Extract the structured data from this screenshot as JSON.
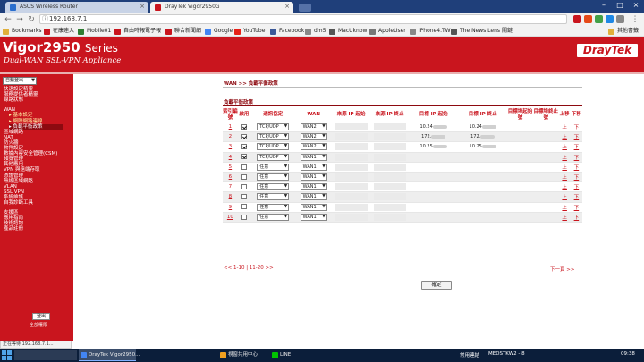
{
  "browser": {
    "tabs": [
      {
        "title": "ASUS Wireless Router",
        "active": false,
        "favicon_color": "#2a6fcf"
      },
      {
        "title": "DrayTek Vigor2950G",
        "active": true,
        "favicon_color": "#c9151e"
      }
    ],
    "address": "192.168.7.1",
    "bookmarks": [
      {
        "label": "Bookmarks",
        "color": "#e0b03c"
      },
      {
        "label": "在康連入",
        "color": "#c9151e"
      },
      {
        "label": "Mobile01",
        "color": "#2e7d32"
      },
      {
        "label": "自由時報電子報",
        "color": "#c9151e"
      },
      {
        "label": "聯合新聞網",
        "color": "#c9151e"
      },
      {
        "label": "Google",
        "color": "#4285f4"
      },
      {
        "label": "YouTube",
        "color": "#e62117"
      },
      {
        "label": "Facebook",
        "color": "#3b5998"
      },
      {
        "label": "dm5",
        "color": "#888888"
      },
      {
        "label": "MacUknow",
        "color": "#555555"
      },
      {
        "label": "AppleUser",
        "color": "#777777"
      },
      {
        "label": "iPhone4.TW",
        "color": "#888888"
      },
      {
        "label": "The News Lens 關鍵",
        "color": "#555555"
      }
    ],
    "other_bookmarks": "其他書籤",
    "status_text": "正在等待 192.168.7.1..."
  },
  "header": {
    "model": "Vigor2950",
    "series": "Series",
    "subtitle": "Dual-WAN SSL-VPN Appliance",
    "logo": "DrayTek"
  },
  "sidebar": {
    "select_label": "自動登出",
    "items": [
      {
        "label": "快速設定精靈",
        "level": "top"
      },
      {
        "label": "服務提供者精靈",
        "level": "top"
      },
      {
        "label": "線路狀態",
        "level": "top"
      },
      {
        "label": "WAN",
        "level": "top",
        "gap": true
      },
      {
        "label": "▸ 基本設定",
        "level": "sub"
      },
      {
        "label": "▸ 網際網路連線",
        "level": "sub"
      },
      {
        "label": "▸ 負載平衡政策",
        "level": "current"
      },
      {
        "label": "區域網路",
        "level": "top"
      },
      {
        "label": "NAT",
        "level": "top"
      },
      {
        "label": "防火牆",
        "level": "top"
      },
      {
        "label": "物件設定",
        "level": "top"
      },
      {
        "label": "數據內容安全管理(CSM)",
        "level": "top"
      },
      {
        "label": "頻寬管理",
        "level": "top"
      },
      {
        "label": "其他應用",
        "level": "top"
      },
      {
        "label": "VPN 與遠端存取",
        "level": "top"
      },
      {
        "label": "憑證管理",
        "level": "top"
      },
      {
        "label": "無線區域網路",
        "level": "top"
      },
      {
        "label": "VLAN",
        "level": "top"
      },
      {
        "label": "SSL VPN",
        "level": "top"
      },
      {
        "label": "系統維護",
        "level": "top"
      },
      {
        "label": "自我診斷工具",
        "level": "top"
      },
      {
        "label": "支援區",
        "level": "top",
        "gap": true
      },
      {
        "label": "應用指南",
        "level": "top"
      },
      {
        "label": "技術諮詢",
        "level": "top"
      },
      {
        "label": "產品註冊",
        "level": "top"
      }
    ],
    "logout_label": "登出",
    "permission_text": "全部權限"
  },
  "page": {
    "breadcrumb": "WAN >> 負載平衡政策",
    "section_title": "負載平衡政策",
    "columns": {
      "index": "索引編號",
      "enable": "啟用",
      "protocol": "通訊協定",
      "wan": "WAN",
      "src_ip_start": "來源 IP 起始",
      "src_ip_end": "來源 IP 終止",
      "dst_ip_start": "目標 IP 起始",
      "dst_ip_end": "目標 IP 終止",
      "dst_port_start": "目標埠起始號",
      "dst_port_end": "目標埠終止號",
      "move_up": "上移",
      "move_down": "下移"
    },
    "rows": [
      {
        "index": "1",
        "enabled": true,
        "protocol": "TCP/UDP",
        "wan": "WAN2",
        "dst_start": "10.24",
        "dst_end": "10.24"
      },
      {
        "index": "2",
        "enabled": true,
        "protocol": "TCP/UDP",
        "wan": "WAN2",
        "dst_start": "172.",
        "dst_end": "172."
      },
      {
        "index": "3",
        "enabled": true,
        "protocol": "TCP/UDP",
        "wan": "WAN2",
        "dst_start": "10.25",
        "dst_end": "10.25"
      },
      {
        "index": "4",
        "enabled": true,
        "protocol": "TCP/UDP",
        "wan": "WAN1",
        "dst_start": "",
        "dst_end": ""
      },
      {
        "index": "5",
        "enabled": false,
        "protocol": "任意",
        "wan": "WAN1",
        "dst_start": "",
        "dst_end": ""
      },
      {
        "index": "6",
        "enabled": false,
        "protocol": "任意",
        "wan": "WAN1",
        "dst_start": "",
        "dst_end": ""
      },
      {
        "index": "7",
        "enabled": false,
        "protocol": "任意",
        "wan": "WAN1",
        "dst_start": "",
        "dst_end": ""
      },
      {
        "index": "8",
        "enabled": false,
        "protocol": "任意",
        "wan": "WAN1",
        "dst_start": "",
        "dst_end": ""
      },
      {
        "index": "9",
        "enabled": false,
        "protocol": "任意",
        "wan": "WAN1",
        "dst_start": "",
        "dst_end": ""
      },
      {
        "index": "10",
        "enabled": false,
        "protocol": "任意",
        "wan": "WAN1",
        "dst_start": "",
        "dst_end": ""
      }
    ],
    "move_up_label": "上",
    "move_down_label": "下",
    "pager_prev": "<< 1-10 | 11-20 >>",
    "pager_next": "下一頁 >>",
    "ok_label": "確定"
  },
  "taskbar": {
    "tasks": [
      {
        "label": "DrayTek Vigor2950...",
        "color": "#4285f4",
        "active": true
      },
      {
        "label": "視窗共用中心",
        "color": "#f0a020",
        "active": false
      },
      {
        "label": "LINE",
        "color": "#00c300",
        "active": false
      }
    ],
    "tray_items": [
      "常用連結",
      "MEDSTKW2 - 8"
    ],
    "clock": "09:38"
  }
}
